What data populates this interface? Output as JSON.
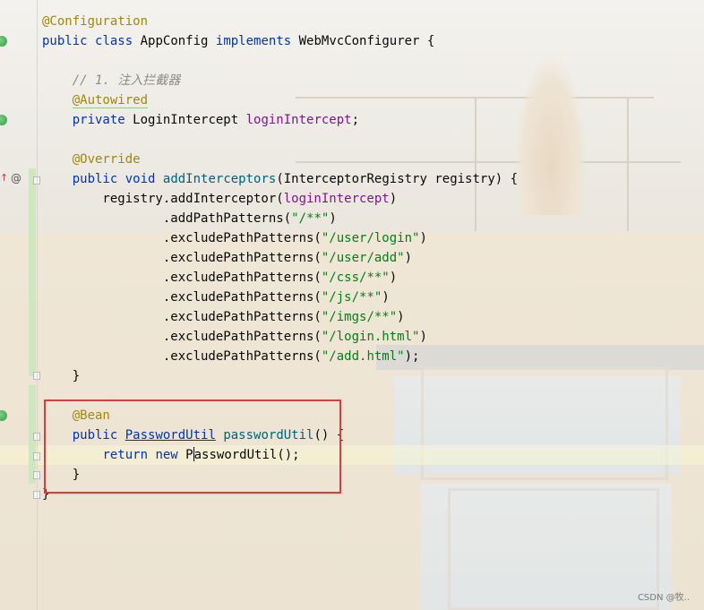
{
  "editor": {
    "lines": [
      [
        {
          "t": "@Configuration",
          "c": "ann"
        }
      ],
      [
        {
          "t": "public",
          "c": "kw"
        },
        {
          "t": " "
        },
        {
          "t": "class",
          "c": "kw"
        },
        {
          "t": " AppConfig "
        },
        {
          "t": "implements",
          "c": "kw"
        },
        {
          "t": " WebMvcConfigurer {"
        }
      ],
      [],
      [
        {
          "t": "    // 1. 注入拦截器",
          "c": "cmt"
        }
      ],
      [
        {
          "t": "    "
        },
        {
          "t": "@Autowired",
          "c": "ann ul-green"
        }
      ],
      [
        {
          "t": "    "
        },
        {
          "t": "private",
          "c": "kw"
        },
        {
          "t": " LoginIntercept "
        },
        {
          "t": "loginIntercept",
          "c": "fld"
        },
        {
          "t": ";"
        }
      ],
      [],
      [
        {
          "t": "    "
        },
        {
          "t": "@Override",
          "c": "ann"
        }
      ],
      [
        {
          "t": "    "
        },
        {
          "t": "public",
          "c": "kw"
        },
        {
          "t": " "
        },
        {
          "t": "void",
          "c": "kw"
        },
        {
          "t": " "
        },
        {
          "t": "addInterceptors",
          "c": "fn"
        },
        {
          "t": "(InterceptorRegistry registry) {"
        }
      ],
      [
        {
          "t": "        registry.addInterceptor("
        },
        {
          "t": "loginIntercept",
          "c": "fld"
        },
        {
          "t": ")"
        }
      ],
      [
        {
          "t": "                .addPathPatterns("
        },
        {
          "t": "\"/**\"",
          "c": "str"
        },
        {
          "t": ")"
        }
      ],
      [
        {
          "t": "                .excludePathPatterns("
        },
        {
          "t": "\"/user/login\"",
          "c": "str"
        },
        {
          "t": ")"
        }
      ],
      [
        {
          "t": "                .excludePathPatterns("
        },
        {
          "t": "\"/user/add\"",
          "c": "str"
        },
        {
          "t": ")"
        }
      ],
      [
        {
          "t": "                .excludePathPatterns("
        },
        {
          "t": "\"/css/**\"",
          "c": "str"
        },
        {
          "t": ")"
        }
      ],
      [
        {
          "t": "                .excludePathPatterns("
        },
        {
          "t": "\"/js/**\"",
          "c": "str"
        },
        {
          "t": ")"
        }
      ],
      [
        {
          "t": "                .excludePathPatterns("
        },
        {
          "t": "\"/imgs/**\"",
          "c": "str"
        },
        {
          "t": ")"
        }
      ],
      [
        {
          "t": "                .excludePathPatterns("
        },
        {
          "t": "\"/login.html\"",
          "c": "str"
        },
        {
          "t": ")"
        }
      ],
      [
        {
          "t": "                .excludePathPatterns("
        },
        {
          "t": "\"/add.html\"",
          "c": "str"
        },
        {
          "t": ");"
        }
      ],
      [
        {
          "t": "    }"
        }
      ],
      [],
      [
        {
          "t": "    "
        },
        {
          "t": "@Bean",
          "c": "ann"
        }
      ],
      [
        {
          "t": "    "
        },
        {
          "t": "public",
          "c": "kw"
        },
        {
          "t": " "
        },
        {
          "t": "PasswordUtil",
          "c": "cls-link"
        },
        {
          "t": " "
        },
        {
          "t": "passwordUtil",
          "c": "fn"
        },
        {
          "t": "() {"
        }
      ],
      [
        {
          "t": "        "
        },
        {
          "t": "return",
          "c": "kw"
        },
        {
          "t": " "
        },
        {
          "t": "new",
          "c": "kw"
        },
        {
          "t": " P"
        },
        {
          "caret": true
        },
        {
          "t": "asswordUtil();"
        }
      ],
      [
        {
          "t": "    }"
        }
      ],
      [
        {
          "t": "}"
        }
      ]
    ]
  },
  "watermark": "CSDN @牧..",
  "gutter": {
    "at_symbol": "@",
    "override_arrow": "↑"
  },
  "colors": {
    "annotation": "#9e880d",
    "keyword": "#0033b3",
    "string": "#067d17",
    "method": "#00627a",
    "field": "#871094",
    "comment": "#8c8c8c",
    "highlight_border": "#e03a3a"
  }
}
